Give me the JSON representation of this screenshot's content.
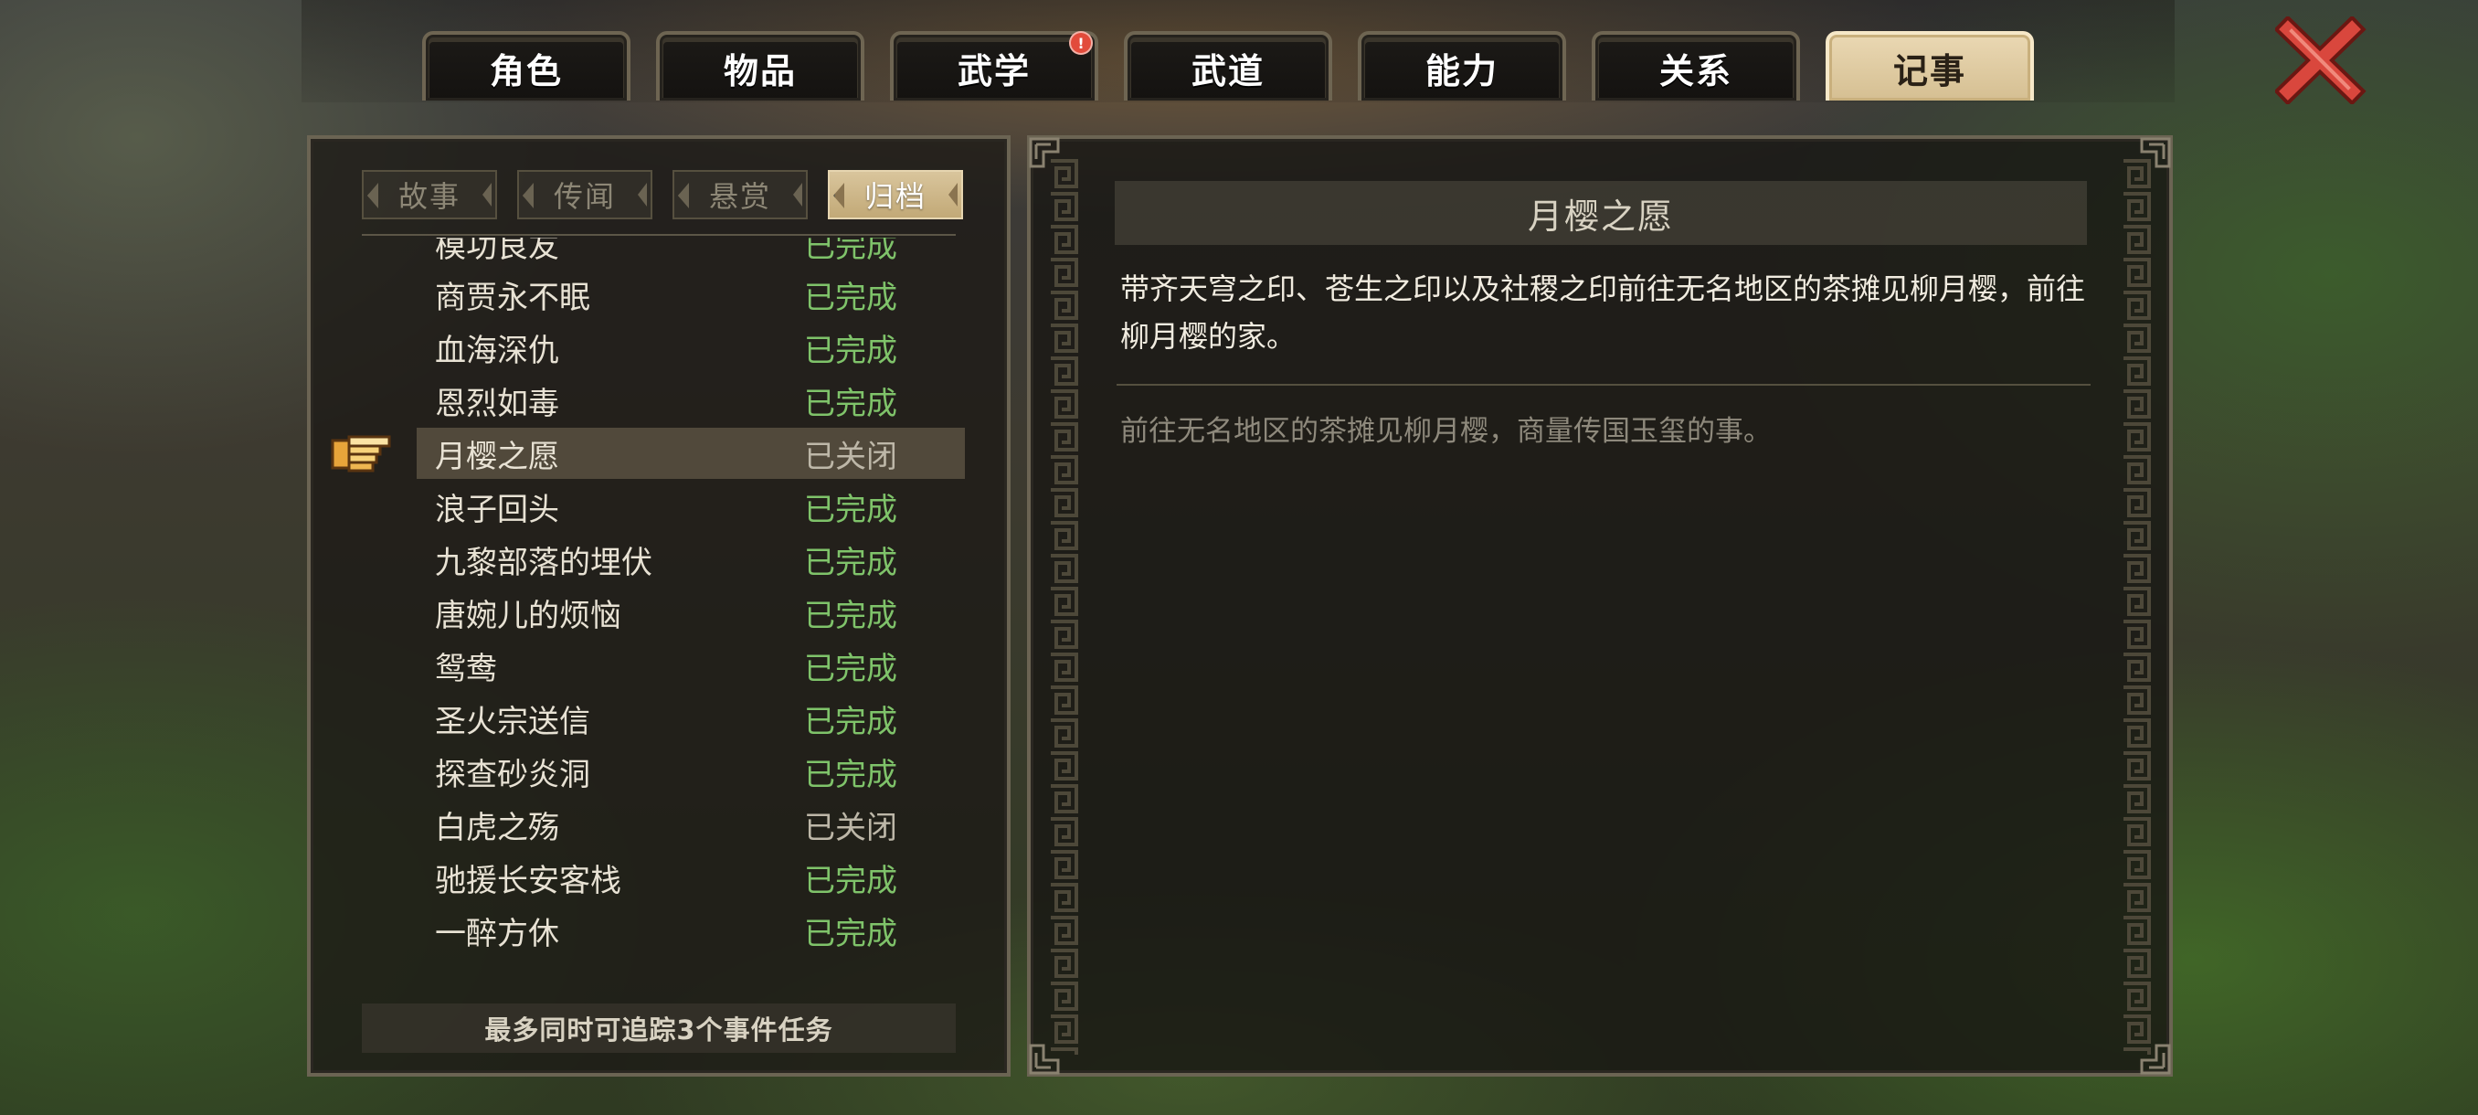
{
  "tabs": [
    {
      "label": "角色"
    },
    {
      "label": "物品"
    },
    {
      "label": "武学",
      "badge": "!"
    },
    {
      "label": "武道"
    },
    {
      "label": "能力"
    },
    {
      "label": "关系"
    },
    {
      "label": "记事",
      "active": true
    }
  ],
  "subtabs": [
    {
      "label": "故事"
    },
    {
      "label": "传闻"
    },
    {
      "label": "悬赏"
    },
    {
      "label": "归档",
      "active": true
    }
  ],
  "quests": [
    {
      "name": "模功良友",
      "status": "已完成",
      "state": "done"
    },
    {
      "name": "商贾永不眠",
      "status": "已完成",
      "state": "done"
    },
    {
      "name": "血海深仇",
      "status": "已完成",
      "state": "done"
    },
    {
      "name": "恩烈如毒",
      "status": "已完成",
      "state": "done"
    },
    {
      "name": "月樱之愿",
      "status": "已关闭",
      "state": "closed",
      "selected": true
    },
    {
      "name": "浪子回头",
      "status": "已完成",
      "state": "done"
    },
    {
      "name": "九黎部落的埋伏",
      "status": "已完成",
      "state": "done"
    },
    {
      "name": "唐婉儿的烦恼",
      "status": "已完成",
      "state": "done"
    },
    {
      "name": "鸳鸯",
      "status": "已完成",
      "state": "done"
    },
    {
      "name": "圣火宗送信",
      "status": "已完成",
      "state": "done"
    },
    {
      "name": "探查砂炎洞",
      "status": "已完成",
      "state": "done"
    },
    {
      "name": "白虎之殇",
      "status": "已关闭",
      "state": "closed"
    },
    {
      "name": "驰援长安客栈",
      "status": "已完成",
      "state": "done"
    },
    {
      "name": "一醉方休",
      "status": "已完成",
      "state": "done"
    }
  ],
  "footer": "最多同时可追踪3个事件任务",
  "detail": {
    "title": "月樱之愿",
    "description": "带齐天穹之印、苍生之印以及社稷之印前往无名地区的茶摊见柳月樱，前往柳月樱的家。",
    "note": "前往无名地区的茶摊见柳月樱，商量传国玉玺的事。"
  },
  "colors": {
    "done": "#7fc36a",
    "closed": "#bdb7a8",
    "active_tab": "#e3cfa6",
    "close_icon": "#d9473d"
  },
  "icons": {
    "close": "close-icon",
    "pointer": "pointing-hand-icon"
  }
}
